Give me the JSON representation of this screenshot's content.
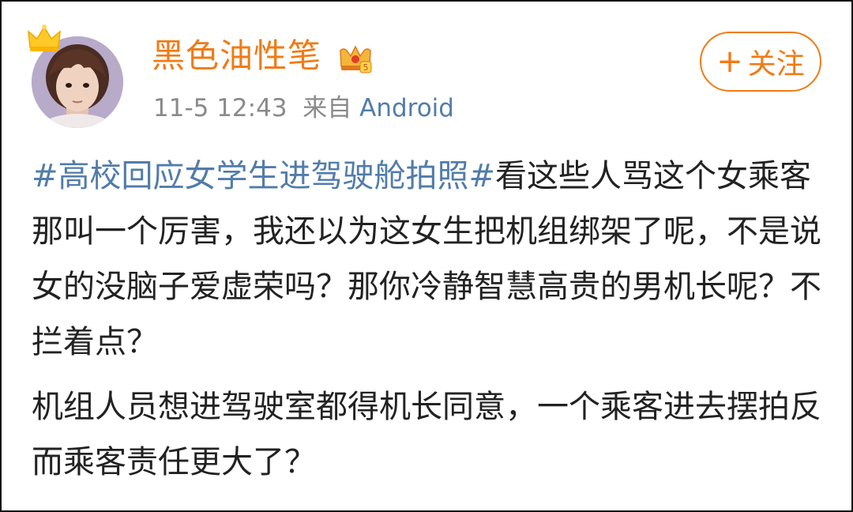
{
  "user": {
    "name": "黑色油性笔",
    "avatar_icon": "user-avatar",
    "crown_badge_icon": "crown-icon",
    "vip_badge_icon": "vip-crown-icon",
    "vip_badge_level": "5"
  },
  "meta": {
    "time": "11-5 12:43",
    "from_label": "来自",
    "source": "Android"
  },
  "follow": {
    "plus": "+",
    "label": "关注"
  },
  "post": {
    "hashtag": "#高校回应女学生进驾驶舱拍照#",
    "paragraph1_text": "看这些人骂这个女乘客那叫一个厉害，我还以为这女生把机组绑架了呢，不是说女的没脑子爱虚荣吗？那你冷静智慧高贵的男机长呢？不拦着点？",
    "paragraph2_text": "机组人员想进驾驶室都得机长同意，一个乘客进去摆拍反而乘客责任更大了？"
  },
  "colors": {
    "accent_orange": "#f07b16",
    "link_blue": "#527caa",
    "meta_gray": "#8a8a8a",
    "text_dark": "#222222"
  }
}
